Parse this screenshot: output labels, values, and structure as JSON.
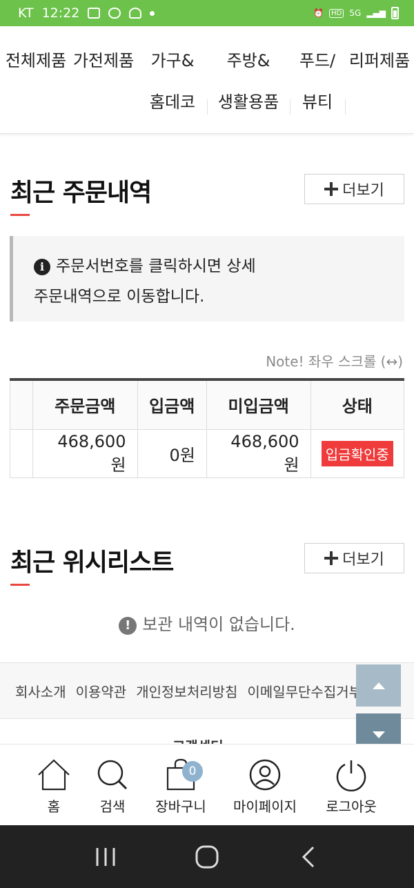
{
  "status_bar": {
    "carrier": "KT",
    "time": "12:22",
    "network": "5G"
  },
  "categories": [
    {
      "line1": "전체제품",
      "line2": ""
    },
    {
      "line1": "가전제품",
      "line2": ""
    },
    {
      "line1": "가구&",
      "line2": "홈데코"
    },
    {
      "line1": "주방&",
      "line2": "생활용품"
    },
    {
      "line1": "푸드/",
      "line2": "뷰티"
    },
    {
      "line1": "리퍼제품",
      "line2": ""
    }
  ],
  "orders": {
    "title": "최근 주문내역",
    "more_label": "더보기",
    "info_line1": "주문서번호를 클릭하시면 상세",
    "info_line2": "주문내역으로 이동합니다.",
    "note": "Note! 좌우 스크롤 (↔)",
    "table": {
      "headers": [
        "주문금액",
        "입금액",
        "미입금액",
        "상태"
      ],
      "row": {
        "amount": "468,600원",
        "paid": "0원",
        "unpaid": "468,600원",
        "status": "입금확인중"
      }
    }
  },
  "wishlist": {
    "title": "최근 위시리스트",
    "more_label": "더보기",
    "empty_message": "보관 내역이 없습니다."
  },
  "footer": {
    "links": [
      "회사소개",
      "이용약관",
      "개인정보처리방침",
      "이메일무단수집거부"
    ],
    "partial_text": "고객센터"
  },
  "tabbar": {
    "items": [
      {
        "label": "홈",
        "icon": "home-icon"
      },
      {
        "label": "검색",
        "icon": "search-icon"
      },
      {
        "label": "장바구니",
        "icon": "cart-icon"
      },
      {
        "label": "마이페이지",
        "icon": "user-icon"
      },
      {
        "label": "로그아웃",
        "icon": "power-icon"
      }
    ],
    "cart_count": "0"
  },
  "colors": {
    "accent": "#e8463f",
    "status_bar": "#6cc24a",
    "badge": "#ef3b3b"
  }
}
